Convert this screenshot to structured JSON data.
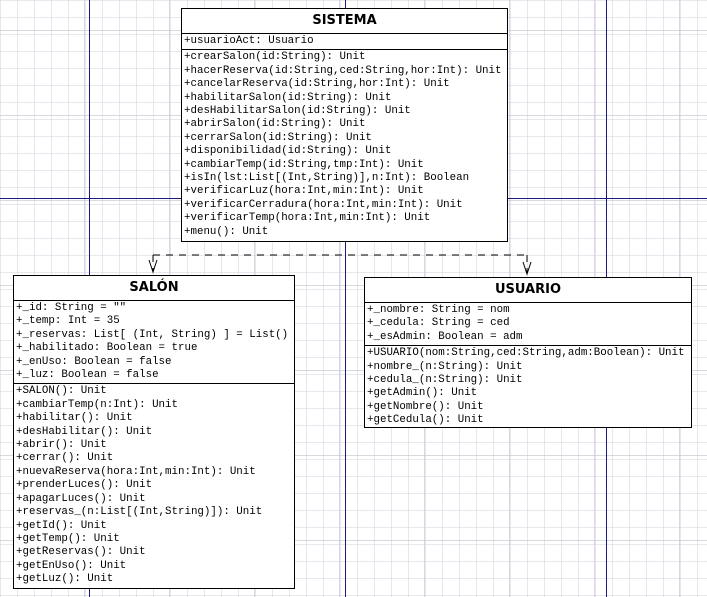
{
  "classes": {
    "sistema": {
      "name": "SISTEMA",
      "attributes": [
        "+usuarioAct: Usuario"
      ],
      "methods": [
        "+crearSalon(id:String): Unit",
        "+hacerReserva(id:String,ced:String,hor:Int): Unit",
        "+cancelarReserva(id:String,hor:Int): Unit",
        "+habilitarSalon(id:String): Unit",
        "+desHabilitarSalon(id:String): Unit",
        "+abrirSalon(id:String): Unit",
        "+cerrarSalon(id:String): Unit",
        "+disponibilidad(id:String): Unit",
        "+cambiarTemp(id:String,tmp:Int): Unit",
        "+isIn(lst:List[(Int,String)],n:Int): Boolean",
        "+verificarLuz(hora:Int,min:Int): Unit",
        "+verificarCerradura(hora:Int,min:Int): Unit",
        "+verificarTemp(hora:Int,min:Int): Unit",
        "+menu(): Unit"
      ]
    },
    "salon": {
      "name": "SALÓN",
      "attributes": [
        "+_id: String = \"\"",
        "+_temp: Int = 35",
        "+_reservas: List[ (Int, String) ] = List()",
        "+_habilitado: Boolean = true",
        "+_enUso: Boolean = false",
        "+_luz: Boolean = false"
      ],
      "methods": [
        "+SALON(): Unit",
        "+cambiarTemp(n:Int): Unit",
        "+habilitar(): Unit",
        "+desHabilitar(): Unit",
        "+abrir(): Unit",
        "+cerrar(): Unit",
        "+nuevaReserva(hora:Int,min:Int): Unit",
        "+prenderLuces(): Unit",
        "+apagarLuces(): Unit",
        "+reservas_(n:List[(Int,String)]): Unit",
        "+getId(): Unit",
        "+getTemp(): Unit",
        "+getReservas(): Unit",
        "+getEnUso(): Unit",
        "+getLuz(): Unit"
      ]
    },
    "usuario": {
      "name": "USUARIO",
      "attributes": [
        "+_nombre: String = nom",
        "+_cedula: String = ced",
        "+_esAdmin: Boolean = adm"
      ],
      "methods": [
        "+USUARIO(nom:String,ced:String,adm:Boolean): Unit",
        "+nombre_(n:String): Unit",
        "+cedula_(n:String): Unit",
        "+getAdmin(): Unit",
        "+getNombre(): Unit",
        "+getCedula(): Unit"
      ]
    }
  },
  "relations": [
    {
      "from": "SISTEMA",
      "to": "SALÓN",
      "type": "dependency"
    },
    {
      "from": "SISTEMA",
      "to": "USUARIO",
      "type": "dependency"
    }
  ],
  "colors": {
    "guide": "#1a1a80",
    "line": "#000000"
  }
}
